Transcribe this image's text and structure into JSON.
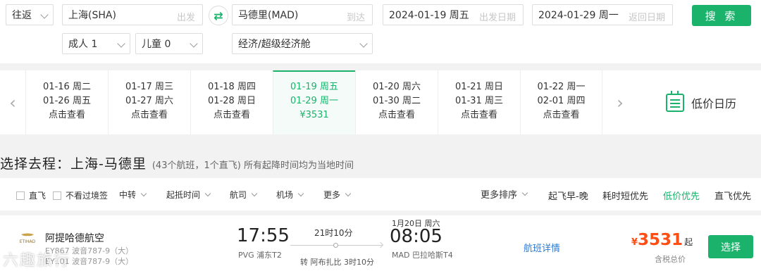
{
  "search": {
    "trip_type": "往返",
    "from_city": "上海(SHA)",
    "from_placeholder": "出发",
    "to_city": "马德里(MAD)",
    "to_placeholder": "到达",
    "depart_date": "2024-01-19 周五",
    "depart_placeholder": "出发日期",
    "return_date": "2024-01-29 周一",
    "return_placeholder": "返回日期",
    "adults": "成人 1",
    "children": "儿童 0",
    "cabin": "经济/超级经济舱",
    "search_button": "搜 索",
    "swap_icon": "swap-icon"
  },
  "date_bar": {
    "cells": [
      {
        "depart": "01-16 周二",
        "return": "01-26 周五",
        "price": "点击查看"
      },
      {
        "depart": "01-17 周三",
        "return": "01-27 周六",
        "price": "点击查看"
      },
      {
        "depart": "01-18 周四",
        "return": "01-28 周日",
        "price": "点击查看"
      },
      {
        "depart": "01-19 周五",
        "return": "01-29 周一",
        "price": "¥3531"
      },
      {
        "depart": "01-20 周六",
        "return": "01-30 周二",
        "price": "点击查看"
      },
      {
        "depart": "01-21 周日",
        "return": "01-31 周三",
        "price": "点击查看"
      },
      {
        "depart": "01-22 周一",
        "return": "02-01 周四",
        "price": "点击查看"
      }
    ],
    "active_index": 3,
    "calendar_label": "低价日历"
  },
  "route": {
    "title": "选择去程：上海-马德里",
    "subtitle": "(43个航班，1个直飞) 所有起降时间均为当地时间"
  },
  "filters": {
    "checkboxes": [
      "直飞",
      "不看过境签"
    ],
    "dropdowns": [
      "中转",
      "起抵时间",
      "航司",
      "机场",
      "更多"
    ],
    "more_sort": "更多排序",
    "sort_options": [
      "起飞早-晚",
      "耗时短优先",
      "低价优先",
      "直飞优先"
    ],
    "active_sort": "低价优先"
  },
  "flight": {
    "airline": "阿提哈德航空",
    "logo_text": "ETIHAD",
    "flight_line_1": "EY867 波音787-9（大）",
    "flight_line_2": "EY101 波音787-9（大）",
    "dep_time": "17:55",
    "dep_airport": "PVG 浦东T2",
    "duration": "21时10分",
    "stop": "转  阿布扎比 3时10分",
    "arr_date": "1月20日 周六",
    "arr_time": "08:05",
    "arr_airport": "MAD 巴拉哈斯T4",
    "detail_link": "航班详情",
    "currency": "¥",
    "price": "3531",
    "price_suffix": "起",
    "tax_note": "含税总价",
    "select_button": "选择"
  },
  "watermark": "六趣旅行"
}
